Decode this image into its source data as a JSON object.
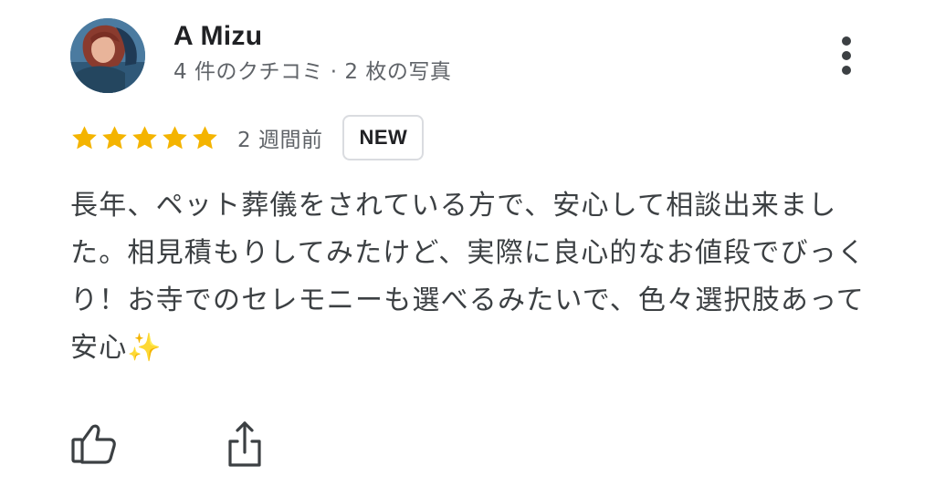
{
  "review": {
    "author_name": "A Mizu",
    "author_meta": "4 件のクチコミ · 2 枚の写真",
    "rating": 5,
    "rating_max": 5,
    "time_ago": "2 週間前",
    "badge": "NEW",
    "text": "長年、ペット葬儀をされている方で、安心して相談出来ました。相見積もりしてみたけど、実際に良心的なお値段でびっくり！お寺でのセレモニーも選べるみたいで、色々選択肢あって安心✨"
  },
  "icons": {
    "avatar": "user-avatar-photo",
    "more": "more-vert-icon",
    "star": "star-filled-icon",
    "like": "thumb-up-icon",
    "share": "share-icon"
  },
  "colors": {
    "star": "#f4b400",
    "text_primary": "#202124",
    "text_secondary": "#5f6368",
    "badge_border": "#dadce0"
  }
}
